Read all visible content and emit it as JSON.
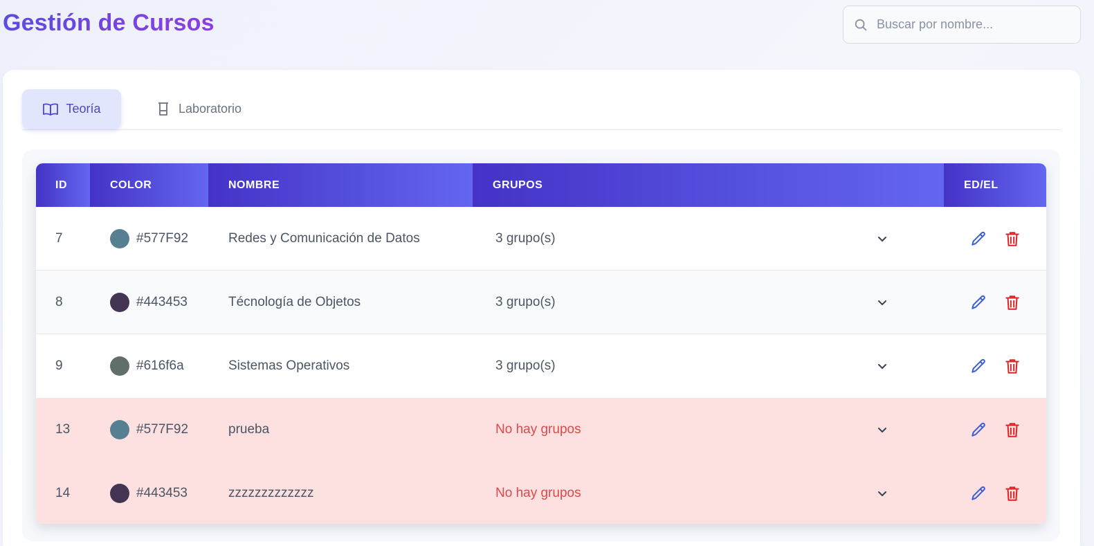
{
  "header": {
    "title": "Gestión de Cursos",
    "search_placeholder": "Buscar por nombre..."
  },
  "tabs": [
    {
      "label": "Teoría",
      "icon": "book-open-icon",
      "active": true
    },
    {
      "label": "Laboratorio",
      "icon": "beaker-icon",
      "active": false
    }
  ],
  "table": {
    "columns": [
      "ID",
      "COLOR",
      "NOMBRE",
      "GRUPOS",
      "ED/EL"
    ],
    "rows": [
      {
        "id": "7",
        "color": "#577F92",
        "nombre": "Redes y Comunicación de Datos",
        "grupos": "3 grupo(s)"
      },
      {
        "id": "8",
        "color": "#443453",
        "nombre": "Técnología de Objetos",
        "grupos": "3 grupo(s)"
      },
      {
        "id": "9",
        "color": "#616f6a",
        "nombre": "Sistemas Operativos",
        "grupos": "3 grupo(s)"
      },
      {
        "id": "13",
        "color": "#577F92",
        "nombre": "prueba",
        "grupos": "No hay grupos"
      },
      {
        "id": "14",
        "color": "#443453",
        "nombre": "zzzzzzzzzzzzz",
        "grupos": "No hay grupos"
      }
    ]
  },
  "colors": {
    "accent": "#4f46e5",
    "edit": "#3b5fd6",
    "delete": "#dc2626",
    "warning_row": "#fde0e0"
  }
}
